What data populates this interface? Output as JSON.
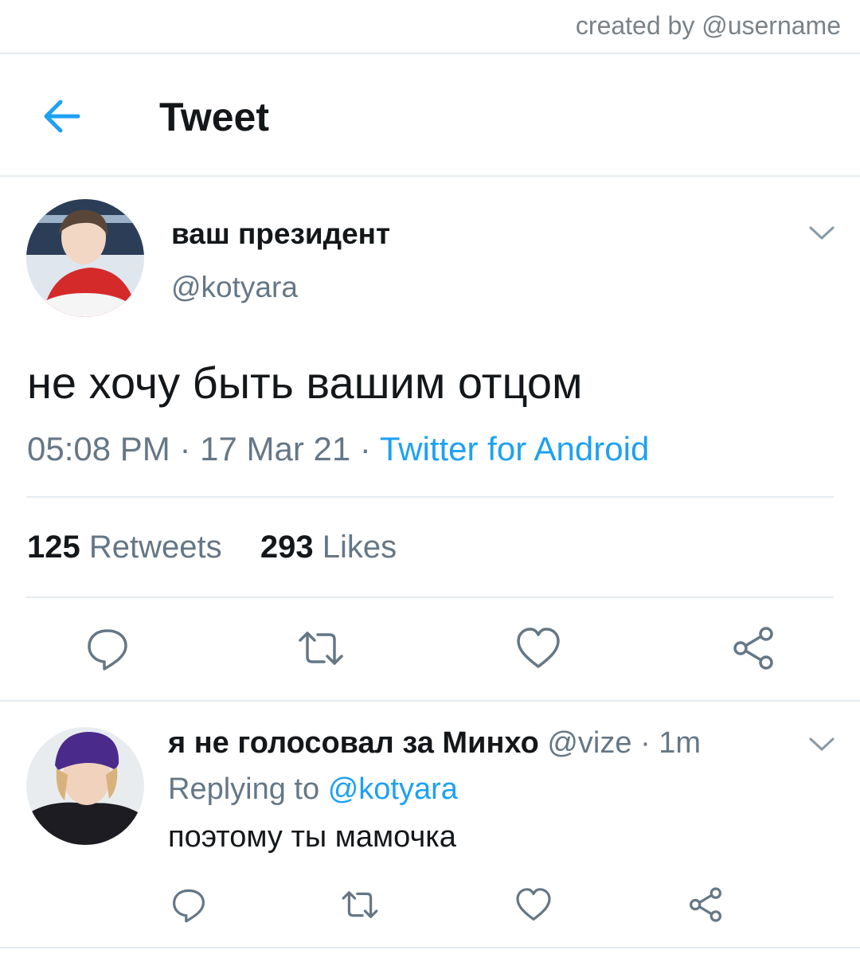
{
  "watermark": "created by @username",
  "header": {
    "title": "Tweet"
  },
  "tweet": {
    "author_name": "ваш президент",
    "author_handle": "@kotyara",
    "text": "не хочу быть вашим отцом",
    "time": "05:08 PM",
    "date": "17 Mar 21",
    "separator": "·",
    "source": "Twitter for Android",
    "retweets_count": "125",
    "retweets_label": "Retweets",
    "likes_count": "293",
    "likes_label": "Likes"
  },
  "reply": {
    "author_name": "я не голосовал за Минхо",
    "author_handle": "@vize",
    "time": "1m",
    "separator": "·",
    "replying_to_label": "Replying to",
    "replying_to_handle": "@kotyara",
    "text": "поэтому ты мамочка"
  },
  "icons": {
    "back": "arrow-left-icon",
    "menu": "chevron-down-icon",
    "actions": [
      "reply-icon",
      "retweet-icon",
      "like-icon",
      "share-icon"
    ]
  },
  "colors": {
    "accent": "#1da1f2",
    "secondary_text": "#657786",
    "divider": "#e6ecf0"
  }
}
